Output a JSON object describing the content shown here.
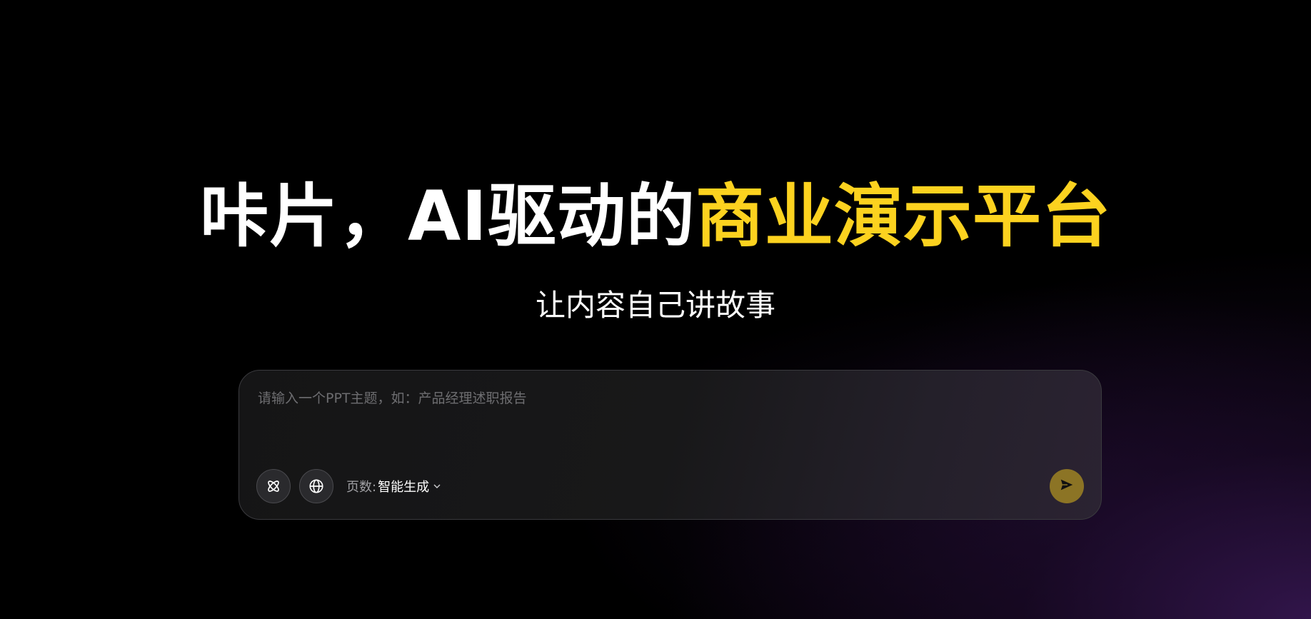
{
  "hero": {
    "title_main": "咔片，AI驱动的",
    "title_accent": "商业演示平台",
    "subtitle": "让内容自己讲故事"
  },
  "prompt": {
    "placeholder": "请输入一个PPT主题，如：产品经理述职报告",
    "value": "",
    "tools": {
      "model_icon": "atom-icon",
      "web_icon": "globe-icon"
    },
    "pages_label": "页数:",
    "pages_value": "智能生成",
    "send_icon": "send-arrow-icon"
  },
  "colors": {
    "accent": "#fcd21f",
    "send_button": "#8c7425",
    "background": "#000000",
    "box_border": "#3a3a3e"
  }
}
